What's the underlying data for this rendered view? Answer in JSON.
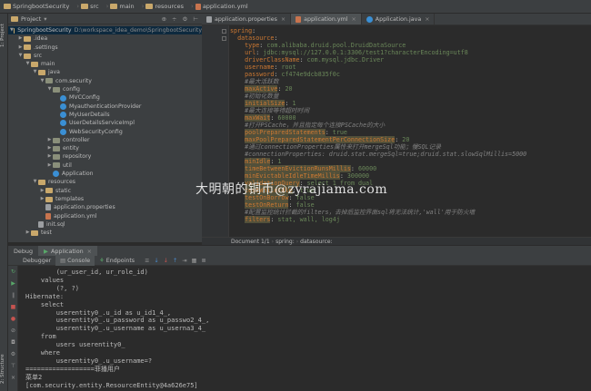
{
  "breadcrumbs": [
    "SpringbootSecurity",
    "src",
    "main",
    "resources",
    "application.yml"
  ],
  "left_strip": {
    "top_tab": "1: Project",
    "bottom_tab": "2: Structure"
  },
  "project_panel": {
    "title": "Project",
    "tree": [
      {
        "label": "SpringbootSecurity",
        "hint": "D:\\workspace_idea_demo\\SpringbootSecurity",
        "icon": "folder",
        "depth": 0,
        "arrow": "open"
      },
      {
        "label": ".idea",
        "icon": "folder",
        "depth": 1,
        "arrow": "closed"
      },
      {
        "label": ".settings",
        "icon": "folder",
        "depth": 1,
        "arrow": "closed"
      },
      {
        "label": "src",
        "icon": "folder",
        "depth": 1,
        "arrow": "open"
      },
      {
        "label": "main",
        "icon": "folder",
        "depth": 2,
        "arrow": "open"
      },
      {
        "label": "java",
        "icon": "folder",
        "depth": 3,
        "arrow": "open"
      },
      {
        "label": "com.security",
        "icon": "package",
        "depth": 4,
        "arrow": "open"
      },
      {
        "label": "config",
        "icon": "package",
        "depth": 5,
        "arrow": "open"
      },
      {
        "label": "MVCConfig",
        "icon": "class",
        "depth": 6,
        "arrow": ""
      },
      {
        "label": "MyauthenticationProvider",
        "icon": "class",
        "depth": 6,
        "arrow": ""
      },
      {
        "label": "MyUserDetails",
        "icon": "class",
        "depth": 6,
        "arrow": ""
      },
      {
        "label": "UserDetailsServiceImpl",
        "icon": "class",
        "depth": 6,
        "arrow": ""
      },
      {
        "label": "WebSecurityConfig",
        "icon": "class",
        "depth": 6,
        "arrow": ""
      },
      {
        "label": "controller",
        "icon": "package",
        "depth": 5,
        "arrow": "closed"
      },
      {
        "label": "entity",
        "icon": "package",
        "depth": 5,
        "arrow": "closed"
      },
      {
        "label": "repository",
        "icon": "package",
        "depth": 5,
        "arrow": "closed"
      },
      {
        "label": "util",
        "icon": "package",
        "depth": 5,
        "arrow": "closed"
      },
      {
        "label": "Application",
        "icon": "class",
        "depth": 5,
        "arrow": ""
      },
      {
        "label": "resources",
        "icon": "folder",
        "depth": 3,
        "arrow": "open"
      },
      {
        "label": "static",
        "icon": "folder",
        "depth": 4,
        "arrow": "closed"
      },
      {
        "label": "templates",
        "icon": "folder",
        "depth": 4,
        "arrow": "closed"
      },
      {
        "label": "application.properties",
        "icon": "file",
        "depth": 4,
        "arrow": ""
      },
      {
        "label": "application.yml",
        "icon": "yml",
        "depth": 4,
        "arrow": ""
      },
      {
        "label": "init.sql",
        "icon": "file",
        "depth": 3,
        "arrow": ""
      },
      {
        "label": "test",
        "icon": "folder",
        "depth": 2,
        "arrow": "closed"
      }
    ]
  },
  "editor_tabs": [
    {
      "label": "application.properties",
      "icon": "file",
      "active": false
    },
    {
      "label": "application.yml",
      "icon": "yml",
      "active": true
    },
    {
      "label": "Application.java",
      "icon": "java",
      "active": false
    }
  ],
  "code_lines": [
    {
      "indent": 0,
      "key": "spring",
      "sep": ":",
      "value": "",
      "style": "key"
    },
    {
      "indent": 2,
      "key": "datasource",
      "sep": ":",
      "value": "",
      "style": "key"
    },
    {
      "indent": 4,
      "key": "type",
      "sep": ": ",
      "value": "com.alibaba.druid.pool.DruidDataSource",
      "style": "key"
    },
    {
      "indent": 4,
      "key": "url",
      "sep": ": ",
      "value": "jdbc:mysql://127.0.0.1:3306/test1?characterEncoding=utf8",
      "style": "key"
    },
    {
      "indent": 4,
      "key": "driverClassName",
      "sep": ": ",
      "value": "com.mysql.jdbc.Driver",
      "style": "key"
    },
    {
      "indent": 4,
      "key": "username",
      "sep": ": ",
      "value": "root",
      "style": "key"
    },
    {
      "indent": 4,
      "key": "password",
      "sep": ": ",
      "value": "cf474e9dcb835f0c",
      "style": "key"
    },
    {
      "indent": 4,
      "key": "#最大活跃数",
      "sep": "",
      "value": "",
      "style": "comment"
    },
    {
      "indent": 4,
      "key": "maxActive",
      "sep": ": ",
      "value": "20",
      "style": "hl"
    },
    {
      "indent": 4,
      "key": "#初始化数量",
      "sep": "",
      "value": "",
      "style": "comment"
    },
    {
      "indent": 4,
      "key": "initialSize",
      "sep": ": ",
      "value": "1",
      "style": "hl"
    },
    {
      "indent": 4,
      "key": "#最大连接等待超时时间",
      "sep": "",
      "value": "",
      "style": "comment"
    },
    {
      "indent": 4,
      "key": "maxWait",
      "sep": ": ",
      "value": "60000",
      "style": "hl"
    },
    {
      "indent": 4,
      "key": "#打开PSCache，并且指定每个连接PSCache的大小",
      "sep": "",
      "value": "",
      "style": "comment"
    },
    {
      "indent": 4,
      "key": "poolPreparedStatements",
      "sep": ": ",
      "value": "true",
      "style": "hl"
    },
    {
      "indent": 4,
      "key": "maxPoolPreparedStatementPerConnectionSize",
      "sep": ": ",
      "value": "20",
      "style": "hl"
    },
    {
      "indent": 4,
      "key": "#通过connectionProperties属性来打开mergeSql功能；慢SQL记录",
      "sep": "",
      "value": "",
      "style": "comment"
    },
    {
      "indent": 4,
      "key": "#connectionProperties: druid.stat.mergeSql=true;druid.stat.slowSqlMillis=5000",
      "sep": "",
      "value": "",
      "style": "comment"
    },
    {
      "indent": 4,
      "key": "minIdle",
      "sep": ": ",
      "value": "1",
      "style": "hl"
    },
    {
      "indent": 4,
      "key": "timeBetweenEvictionRunsMillis",
      "sep": ": ",
      "value": "60000",
      "style": "hl"
    },
    {
      "indent": 4,
      "key": "minEvictableIdleTimeMillis",
      "sep": ": ",
      "value": "300000",
      "style": "hl"
    },
    {
      "indent": 4,
      "key": "validationQuery",
      "sep": ": ",
      "value": "select 1 from dual",
      "style": "hl"
    },
    {
      "indent": 4,
      "key": "testWhileIdle",
      "sep": ": ",
      "value": "true",
      "style": "hl"
    },
    {
      "indent": 4,
      "key": "testOnBorrow",
      "sep": ": ",
      "value": "false",
      "style": "hl"
    },
    {
      "indent": 4,
      "key": "testOnReturn",
      "sep": ": ",
      "value": "false",
      "style": "hl"
    },
    {
      "indent": 4,
      "key": "#配置监控统计拦截的filters，去掉后监控界面sql将无法统计,'wall'用于防火墙",
      "sep": "",
      "value": "",
      "style": "comment"
    },
    {
      "indent": 4,
      "key": "filters",
      "sep": ": ",
      "value": "stat, wall, log4j",
      "style": "hl"
    }
  ],
  "watermark": "大明朝的铜币@zyrajiama.com",
  "editor_breadcrumb": {
    "doc": "Document 1/1",
    "path": [
      "spring:",
      "datasource:"
    ]
  },
  "run_panel": {
    "debug_label": "Debug",
    "tab_label": "Application",
    "toolbar_tabs": [
      "Debugger",
      "Console",
      "Endpoints"
    ],
    "console_lines": [
      "        (ur_user_id, ur_role_id)",
      "    values",
      "        (?, ?)",
      "Hibernate:",
      "    select",
      "        userentity0_.u_id as u_id1_4_,",
      "        userentity0_.u_password as u_passwo2_4_,",
      "        userentity0_.u_username as u_userna3_4_",
      "    from",
      "        users userentity0_",
      "    where",
      "        userentity0_.u_username=?",
      "==================菲播用户",
      "菜单2",
      "[com.security.entity.ResourceEntity@4a626e75]"
    ]
  },
  "colors": {
    "keyword": "#cc7832",
    "string": "#6a8759",
    "comment": "#808080",
    "highlight": "#52503a"
  }
}
